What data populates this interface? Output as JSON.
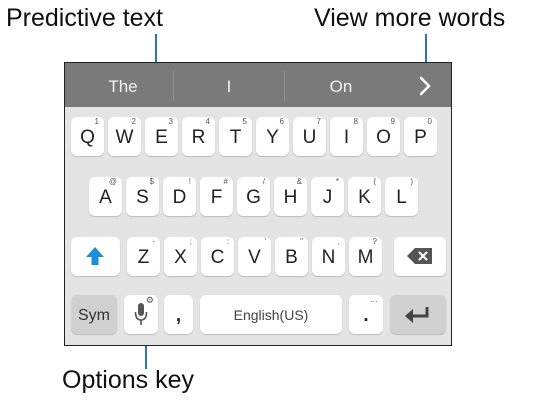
{
  "callouts": {
    "predictive_text": "Predictive text",
    "view_more_words": "View more words",
    "options_key": "Options key"
  },
  "suggestions": [
    "The",
    "I",
    "On"
  ],
  "rows": [
    [
      {
        "main": "Q",
        "hint": "1"
      },
      {
        "main": "W",
        "hint": "2"
      },
      {
        "main": "E",
        "hint": "3"
      },
      {
        "main": "R",
        "hint": "4"
      },
      {
        "main": "T",
        "hint": "5"
      },
      {
        "main": "Y",
        "hint": "6"
      },
      {
        "main": "U",
        "hint": "7"
      },
      {
        "main": "I",
        "hint": "8"
      },
      {
        "main": "O",
        "hint": "9"
      },
      {
        "main": "P",
        "hint": "0"
      }
    ],
    [
      {
        "main": "A",
        "hint": "@"
      },
      {
        "main": "S",
        "hint": "$"
      },
      {
        "main": "D",
        "hint": "!"
      },
      {
        "main": "F",
        "hint": "#"
      },
      {
        "main": "G",
        "hint": "/"
      },
      {
        "main": "H",
        "hint": "&"
      },
      {
        "main": "J",
        "hint": "*"
      },
      {
        "main": "K",
        "hint": "("
      },
      {
        "main": "L",
        "hint": ")"
      }
    ],
    [
      {
        "main": "Z",
        "hint": "-"
      },
      {
        "main": "X",
        "hint": ";"
      },
      {
        "main": "C",
        "hint": ":"
      },
      {
        "main": "V",
        "hint": "'"
      },
      {
        "main": "B",
        "hint": "\""
      },
      {
        "main": "N",
        "hint": ","
      },
      {
        "main": "M",
        "hint": "?"
      }
    ]
  ],
  "bottom_row": {
    "sym": "Sym",
    "comma": ",",
    "space": "English(US)",
    "period": ".",
    "period_hint": "…"
  },
  "icons": {
    "more_words": "chevron-right-icon",
    "shift": "shift-arrow-icon",
    "backspace": "backspace-icon",
    "mic": "microphone-icon",
    "enter": "enter-icon"
  },
  "colors": {
    "accent": "#2b73b8",
    "shift_active": "#1d8ed8",
    "prediction_bar": "#7a7a7a",
    "keyboard_bg": "#e4e4e4",
    "key_bg": "#ffffff"
  }
}
